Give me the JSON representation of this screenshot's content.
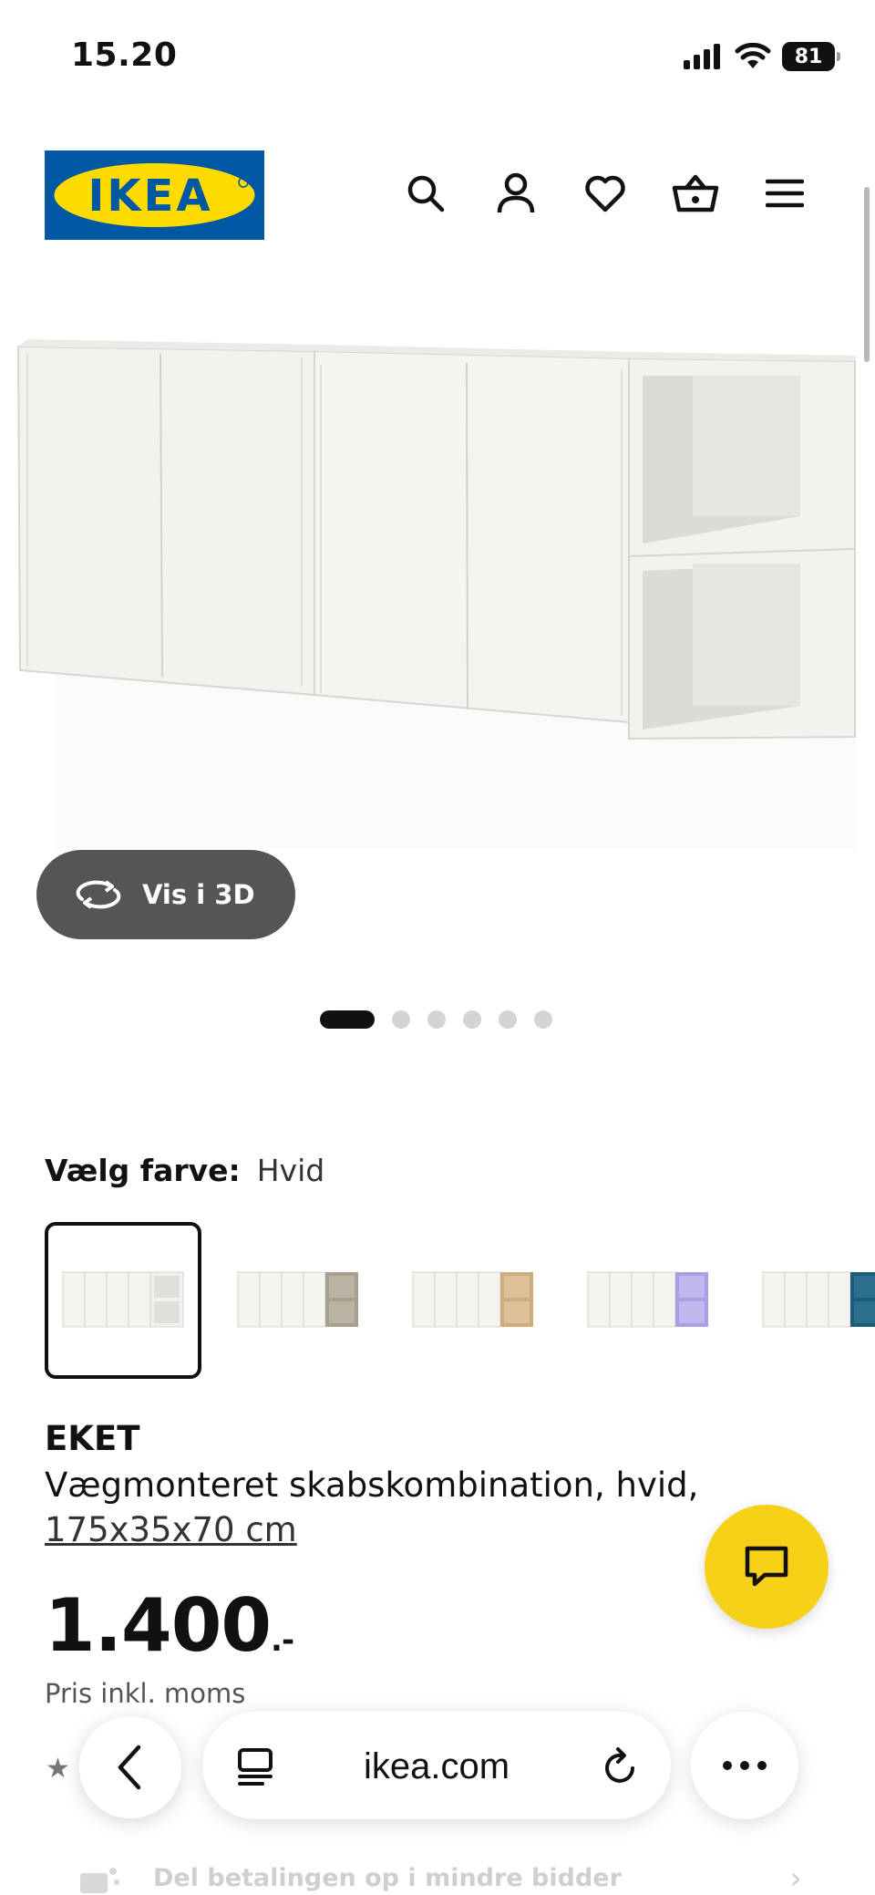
{
  "status_bar": {
    "time": "15.20",
    "battery": "81"
  },
  "header": {
    "logo_text": "IKEA",
    "colors": {
      "logo_blue": "#0058A3",
      "logo_yellow": "#FFDB00"
    },
    "icons": [
      "search-icon",
      "account-icon",
      "heart-icon",
      "basket-icon",
      "menu-icon"
    ]
  },
  "gallery": {
    "view_3d_label": "Vis i 3D",
    "dots_total": 6,
    "active_dot": 1
  },
  "color_select": {
    "label": "Vælg farve:",
    "value": "Hvid",
    "swatches": [
      {
        "name": "hvid",
        "accent": "#f2f1ee",
        "selected": true
      },
      {
        "name": "graa-beige",
        "accent": "#a8a08e",
        "selected": false
      },
      {
        "name": "egetrae",
        "accent": "#cfac7e",
        "selected": false
      },
      {
        "name": "lilla",
        "accent": "#a99fe2",
        "selected": false
      },
      {
        "name": "moerkeblaa",
        "accent": "#1c5c78",
        "selected": false
      }
    ]
  },
  "product": {
    "name": "EKET",
    "description": "Vægmonteret skabskombination, hvid,",
    "size": "175x35x70 cm",
    "price": "1.400",
    "price_suffix": ".-",
    "price_note": "Pris inkl. moms"
  },
  "chat": {
    "accent": "#F7D117"
  },
  "browser": {
    "url": "ikea.com"
  },
  "promo": {
    "text": "Del betalingen op i mindre bidder"
  }
}
